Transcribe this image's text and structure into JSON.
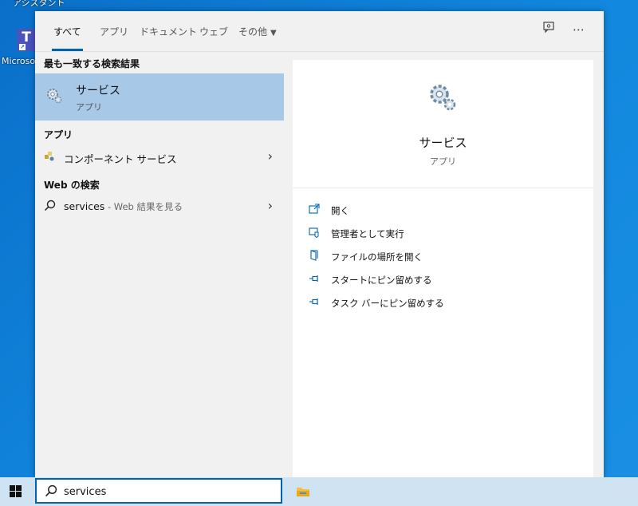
{
  "desktop": {
    "top_label": "アシスタント",
    "icon_caption": "Microsoft",
    "icon_letter": "T"
  },
  "tabs": [
    {
      "label": "すべて",
      "active": true
    },
    {
      "label": "アプリ"
    },
    {
      "label": "ドキュメント"
    },
    {
      "label": "ウェブ"
    },
    {
      "label": "その他"
    }
  ],
  "tab_more_arrow": "▼",
  "top_icons": {
    "feedback": "feedback-icon",
    "more": "⋯"
  },
  "left": {
    "best_match_heading": "最も一致する検索結果",
    "best_match": {
      "title": "サービス",
      "subtitle": "アプリ",
      "icon": "gear-icon"
    },
    "apps_heading": "アプリ",
    "apps": [
      {
        "label": "コンポーネント サービス",
        "icon": "component-services-icon"
      }
    ],
    "web_heading": "Web の検索",
    "web": {
      "query": "services",
      "hint": " - Web 結果を見る"
    },
    "chevron": "›"
  },
  "right": {
    "title": "サービス",
    "subtitle": "アプリ",
    "actions": [
      {
        "label": "開く",
        "icon": "open-icon"
      },
      {
        "label": "管理者として実行",
        "icon": "run-as-admin-icon"
      },
      {
        "label": "ファイルの場所を開く",
        "icon": "file-location-icon"
      },
      {
        "label": "スタートにピン留めする",
        "icon": "pin-icon"
      },
      {
        "label": "タスク バーにピン留めする",
        "icon": "pin-icon"
      }
    ]
  },
  "taskbar": {
    "search_value": "services"
  },
  "colors": {
    "accent": "#0063b1",
    "selected": "#a8c8e8",
    "desktop": "#1288de"
  }
}
